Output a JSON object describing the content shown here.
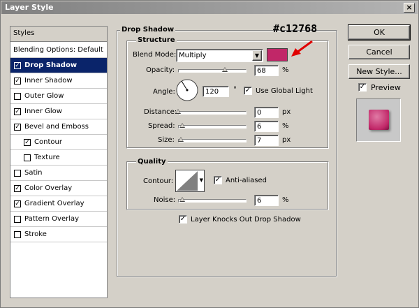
{
  "window": {
    "title": "Layer Style"
  },
  "styles_panel": {
    "header": "Styles",
    "items": [
      {
        "label": "Blending Options: Default",
        "checkbox": false,
        "checked": false,
        "indent": 0,
        "selected": false
      },
      {
        "label": "Drop Shadow",
        "checkbox": true,
        "checked": true,
        "indent": 0,
        "selected": true
      },
      {
        "label": "Inner Shadow",
        "checkbox": true,
        "checked": true,
        "indent": 0,
        "selected": false
      },
      {
        "label": "Outer Glow",
        "checkbox": true,
        "checked": false,
        "indent": 0,
        "selected": false
      },
      {
        "label": "Inner Glow",
        "checkbox": true,
        "checked": true,
        "indent": 0,
        "selected": false
      },
      {
        "label": "Bevel and Emboss",
        "checkbox": true,
        "checked": true,
        "indent": 0,
        "selected": false
      },
      {
        "label": "Contour",
        "checkbox": true,
        "checked": true,
        "indent": 1,
        "selected": false
      },
      {
        "label": "Texture",
        "checkbox": true,
        "checked": false,
        "indent": 1,
        "selected": false
      },
      {
        "label": "Satin",
        "checkbox": true,
        "checked": false,
        "indent": 0,
        "selected": false
      },
      {
        "label": "Color Overlay",
        "checkbox": true,
        "checked": true,
        "indent": 0,
        "selected": false
      },
      {
        "label": "Gradient Overlay",
        "checkbox": true,
        "checked": true,
        "indent": 0,
        "selected": false
      },
      {
        "label": "Pattern Overlay",
        "checkbox": true,
        "checked": false,
        "indent": 0,
        "selected": false
      },
      {
        "label": "Stroke",
        "checkbox": true,
        "checked": false,
        "indent": 0,
        "selected": false
      }
    ]
  },
  "drop_shadow": {
    "title": "Drop Shadow",
    "structure_title": "Structure",
    "blend_mode_label": "Blend Mode:",
    "blend_mode_value": "Multiply",
    "shadow_color": "#c12768",
    "annotation_text": "#c12768",
    "annotation_arrow_color": "#e00000",
    "opacity_label": "Opacity:",
    "opacity_value": "68",
    "opacity_unit": "%",
    "opacity_fraction": 0.68,
    "angle_label": "Angle:",
    "angle_value": "120",
    "angle_unit": "°",
    "use_global_light_label": "Use Global Light",
    "use_global_light_checked": true,
    "distance_label": "Distance:",
    "distance_value": "0",
    "distance_unit": "px",
    "distance_fraction": 0.0,
    "spread_label": "Spread:",
    "spread_value": "6",
    "spread_unit": "%",
    "spread_fraction": 0.06,
    "size_label": "Size:",
    "size_value": "7",
    "size_unit": "px",
    "size_fraction": 0.04,
    "quality_title": "Quality",
    "contour_label": "Contour:",
    "anti_aliased_label": "Anti-aliased",
    "anti_aliased_checked": true,
    "noise_label": "Noise:",
    "noise_value": "6",
    "noise_unit": "%",
    "noise_fraction": 0.06,
    "knockout_label": "Layer Knocks Out Drop Shadow",
    "knockout_checked": true
  },
  "buttons": {
    "ok": "OK",
    "cancel": "Cancel",
    "new_style": "New Style...",
    "preview_label": "Preview",
    "preview_checked": true,
    "preview_swatch_color": "#c12768"
  }
}
